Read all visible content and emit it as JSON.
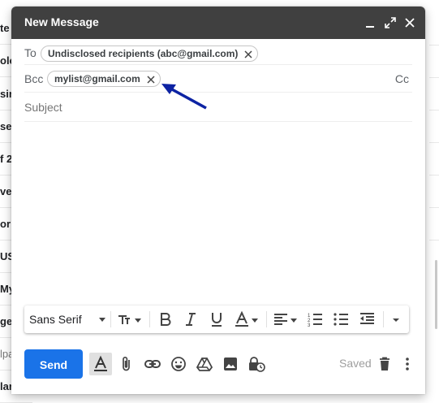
{
  "background": {
    "list_fragments": [
      "te",
      "olo",
      "sir",
      "se",
      "f 2",
      "ve",
      "or",
      "US",
      "My",
      "ge",
      "lpa",
      "lar"
    ]
  },
  "compose": {
    "title": "New Message",
    "controls": [
      "minimize-icon",
      "expand-icon",
      "close-icon"
    ],
    "to": {
      "label": "To",
      "recipient": "Undisclosed recipients (abc@gmail.com)"
    },
    "bcc": {
      "label": "Bcc",
      "recipient": "mylist@gmail.com"
    },
    "cc_label": "Cc",
    "subject": {
      "placeholder": "Subject",
      "value": ""
    },
    "body": "",
    "annotation_arrow_color": "#0d23a3"
  },
  "formatting_toolbar": {
    "font": "Sans Serif",
    "tools": [
      "text-size-icon",
      "bold-icon",
      "italic-icon",
      "underline-icon",
      "text-color-icon",
      "align-icon",
      "numbered-list-icon",
      "bulleted-list-icon",
      "indent-less-icon",
      "more-formatting-icon"
    ]
  },
  "actions": {
    "send_label": "Send",
    "saved_label": "Saved",
    "accent": "#1a73e8",
    "tools": [
      "formatting-options-icon",
      "attach-icon",
      "insert-link-icon",
      "emoji-icon",
      "drive-icon",
      "insert-photo-icon",
      "confidential-mode-icon",
      "discard-icon",
      "more-options-icon"
    ]
  }
}
